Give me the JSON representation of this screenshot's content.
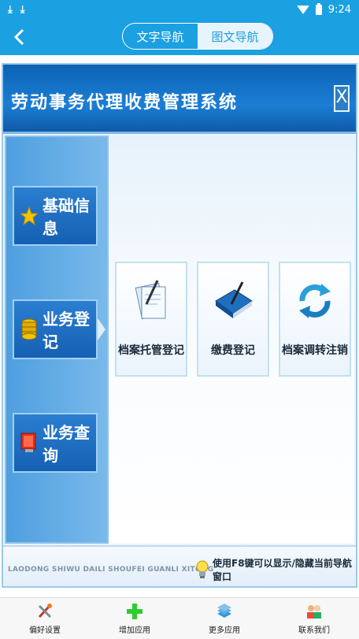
{
  "status_bar": {
    "time": "9:24",
    "left_icons": [
      "download-icon",
      "download-icon"
    ]
  },
  "app_bar": {
    "back_icon": "back-arrow-icon",
    "tabs": [
      {
        "label": "文字导航",
        "active": false
      },
      {
        "label": "图文导航",
        "active": true
      }
    ]
  },
  "window": {
    "title": "劳动事务代理收费管理系统",
    "close_label": "X",
    "sidebar": {
      "items": [
        {
          "label": "基础信息",
          "icon": "star-icon"
        },
        {
          "label": "业务登记",
          "icon": "coins-icon"
        },
        {
          "label": "业务查询",
          "icon": "monitor-icon"
        }
      ],
      "active_index": 1
    },
    "tiles": [
      {
        "label": "档案托管登记",
        "icon": "document-pen-icon"
      },
      {
        "label": "缴费登记",
        "icon": "book-pen-icon"
      },
      {
        "label": "档案调转注销",
        "icon": "refresh-arrows-icon"
      }
    ],
    "footer": {
      "pinyin": "LAODONG SHIWU DAILI SHOUFEI GUANLI XITONG",
      "tip": "使用F8键可以显示/隐藏当前导航窗口"
    }
  },
  "bottom_nav": [
    {
      "label": "偏好设置",
      "icon": "settings-tools-icon"
    },
    {
      "label": "增加应用",
      "icon": "plus-icon"
    },
    {
      "label": "更多应用",
      "icon": "apps-stack-icon"
    },
    {
      "label": "联系我们",
      "icon": "contacts-icon"
    }
  ],
  "colors": {
    "accent": "#1ba0e2",
    "nav_blue": "#1560b4"
  }
}
